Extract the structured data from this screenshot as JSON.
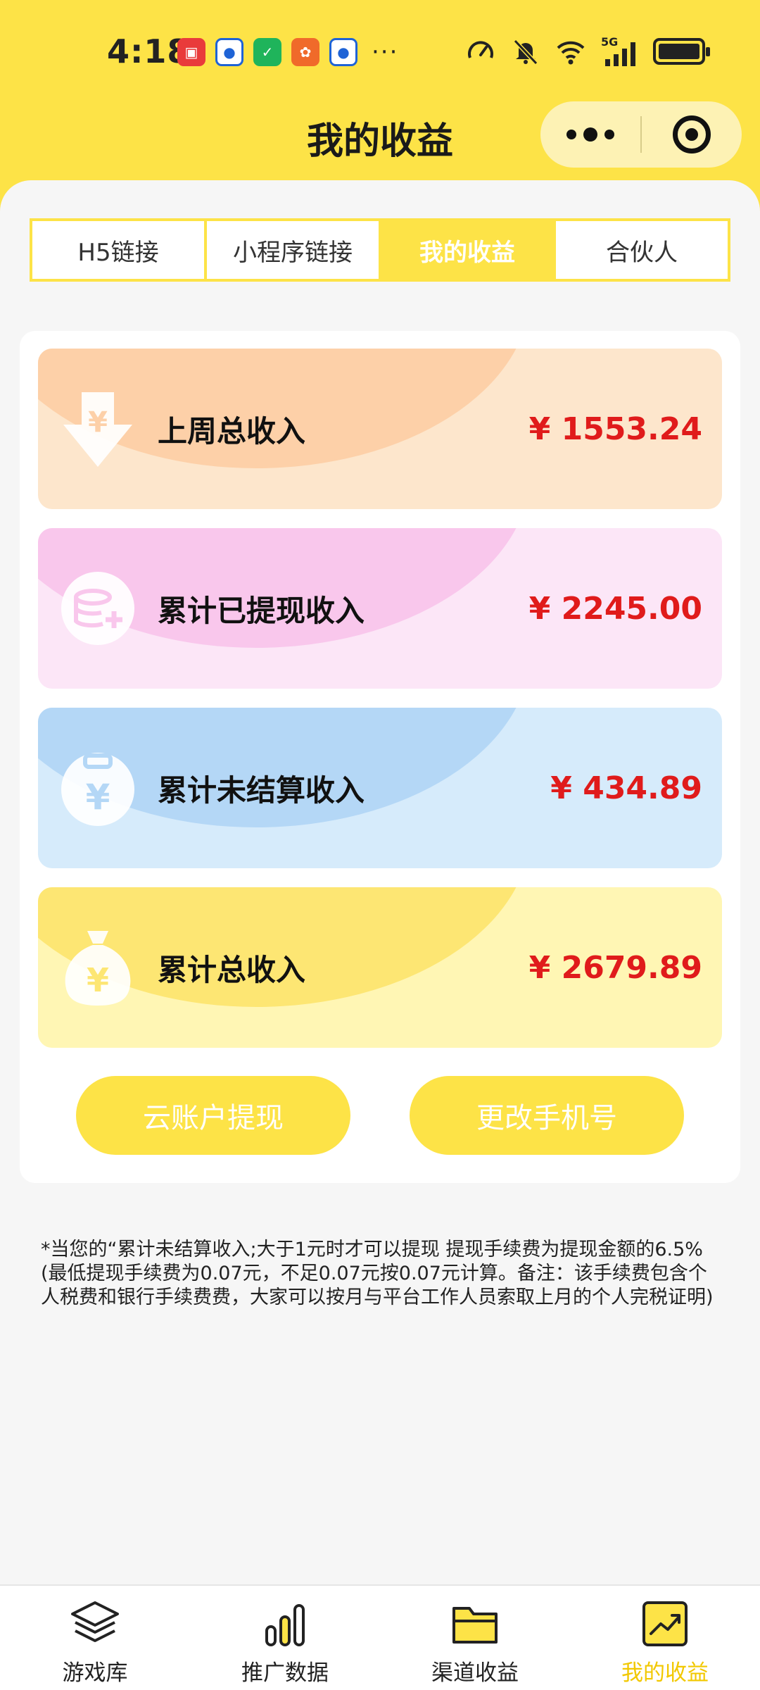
{
  "status_bar": {
    "time": "4:18",
    "network": "5G",
    "app_icons": [
      "huawei-app-icon",
      "blue-app-icon",
      "green-shield-app-icon",
      "orange-app-icon",
      "blue-app-icon-2"
    ],
    "more": "···"
  },
  "nav": {
    "title": "我的收益"
  },
  "tabs": [
    {
      "label": "H5链接",
      "active": false
    },
    {
      "label": "小程序链接",
      "active": false
    },
    {
      "label": "我的收益",
      "active": true
    },
    {
      "label": "合伙人",
      "active": false
    }
  ],
  "cards": [
    {
      "label": "上周总收入",
      "value": "¥ 1553.24",
      "icon": "yen-down-arrow-icon",
      "color": "#fdd0a8"
    },
    {
      "label": "累计已提现收入",
      "value": "¥ 2245.00",
      "icon": "coin-stack-icon",
      "color": "#f9c7ec"
    },
    {
      "label": "累计未结算收入",
      "value": "¥ 434.89",
      "icon": "yen-clipboard-icon",
      "color": "#b4d7f6"
    },
    {
      "label": "累计总收入",
      "value": "¥ 2679.89",
      "icon": "money-bag-icon",
      "color": "#fde673"
    }
  ],
  "buttons": {
    "withdraw": "云账户提现",
    "change_phone": "更改手机号"
  },
  "notice": "*当您的“累计未结算收入;大于1元时才可以提现 提现手续费为提现金额的6.5%(最低提现手续费为0.07元，不足0.07元按0.07元计算。备注：该手续费包含个人税费和银行手续费费，大家可以按月与平台工作人员索取上月的个人完税证明)",
  "bottom_nav": [
    {
      "label": "游戏库",
      "icon": "layers-icon",
      "active": false
    },
    {
      "label": "推广数据",
      "icon": "bar-chart-icon",
      "active": false
    },
    {
      "label": "渠道收益",
      "icon": "folder-icon",
      "active": false
    },
    {
      "label": "我的收益",
      "icon": "trend-up-icon",
      "active": true
    }
  ],
  "colors": {
    "brand_yellow": "#fde347",
    "value_red": "#e01b1b",
    "active_nav": "#f2c800"
  }
}
